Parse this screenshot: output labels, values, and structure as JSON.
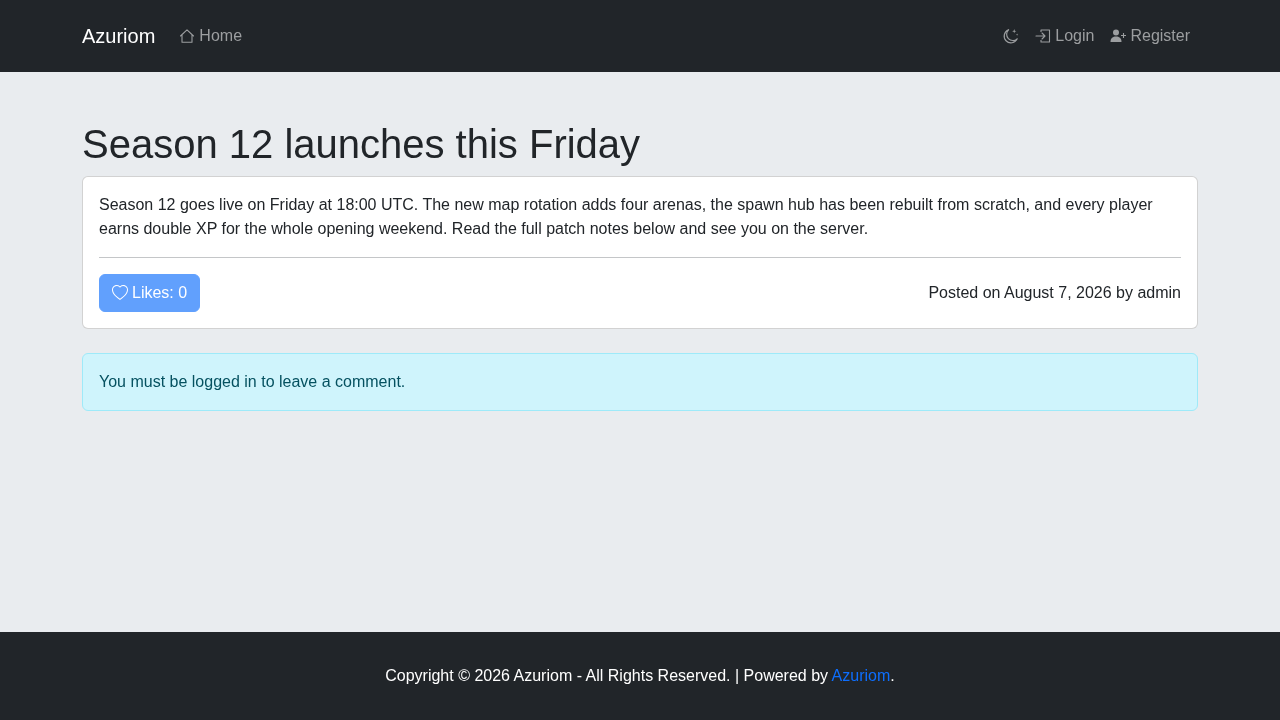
{
  "navbar": {
    "brand": "Azuriom",
    "home": "Home",
    "login": "Login",
    "register": "Register"
  },
  "post": {
    "title": "Season 12 launches this Friday",
    "body": "Season 12 goes live on Friday at 18:00 UTC. The new map rotation adds four arenas, the spawn hub has been rebuilt from scratch, and every player earns double XP for the whole opening weekend. Read the full patch notes below and see you on the server.",
    "like_button": {
      "label": "Likes: 0",
      "disabled": true
    },
    "meta": "Posted on August 7, 2026 by admin"
  },
  "alert": {
    "message": "You must be logged in to leave a comment."
  },
  "footer": {
    "text": "Copyright © 2026 Azuriom - All Rights Reserved. | Powered by",
    "link": "Azuriom",
    "suffix": "."
  }
}
